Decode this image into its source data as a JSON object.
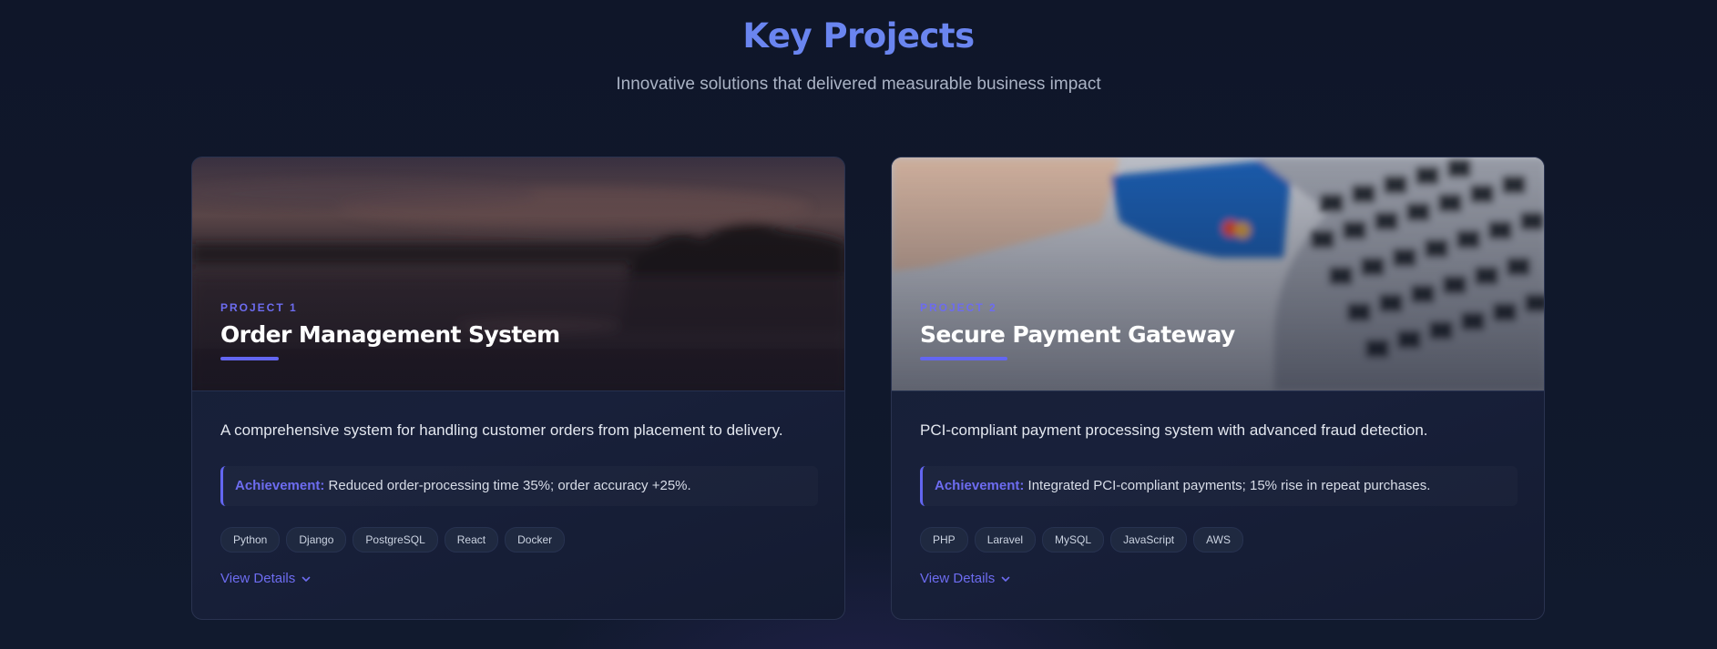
{
  "section": {
    "title": "Key Projects",
    "subtitle": "Innovative solutions that delivered measurable business impact"
  },
  "projects": [
    {
      "label": "PROJECT 1",
      "title": "Order Management System",
      "image": "sunset-landscape-image",
      "description": "A comprehensive system for handling customer orders from placement to delivery.",
      "achievement_label": "Achievement:",
      "achievement_text": "Reduced order-processing time 35%; order accuracy +25%.",
      "tags": [
        "Python",
        "Django",
        "PostgreSQL",
        "React",
        "Docker"
      ],
      "view_details": "View Details"
    },
    {
      "label": "PROJECT 2",
      "title": "Secure Payment Gateway",
      "image": "credit-card-laptop-image",
      "description": "PCI-compliant payment processing system with advanced fraud detection.",
      "achievement_label": "Achievement:",
      "achievement_text": "Integrated PCI-compliant payments; 15% rise in repeat purchases.",
      "tags": [
        "PHP",
        "Laravel",
        "MySQL",
        "JavaScript",
        "AWS"
      ],
      "view_details": "View Details"
    }
  ],
  "colors": {
    "accent": "#6366f1",
    "heading": "#6a85f0",
    "background": "#0f1729"
  }
}
